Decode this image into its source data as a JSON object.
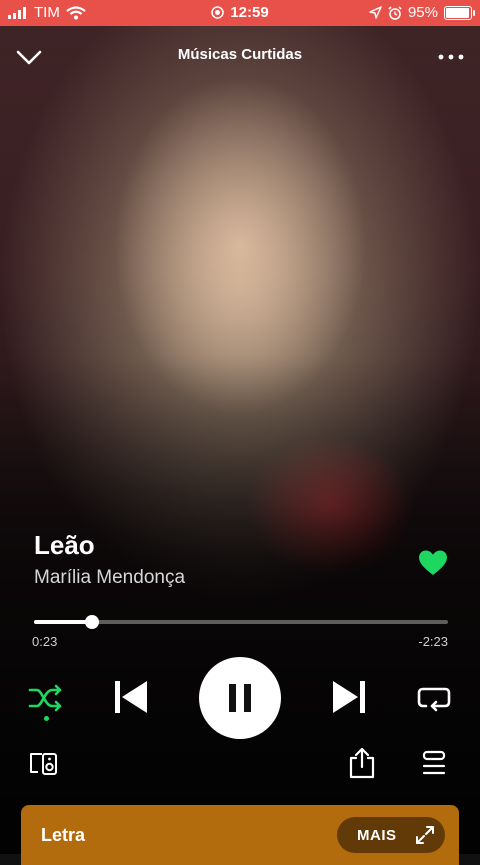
{
  "status_bar": {
    "carrier": "TIM",
    "time": "12:59",
    "battery": "95%",
    "battery_level": 0.95,
    "background": "#e8504a"
  },
  "header": {
    "title": "Músicas Curtidas",
    "icons": {
      "left": "chevron-down-icon",
      "right": "more-options-icon"
    }
  },
  "track": {
    "title": "Leão",
    "artist": "Marília Mendonça",
    "liked": true,
    "like_color": "#1ed760"
  },
  "playback": {
    "elapsed": "0:23",
    "remaining": "-2:23",
    "progress_fraction": 0.14,
    "shuffle_on": true,
    "state": "playing",
    "accent": "#1ed760"
  },
  "lyrics": {
    "label": "Letra",
    "more_label": "MAIS",
    "background": "#b26b0d"
  }
}
